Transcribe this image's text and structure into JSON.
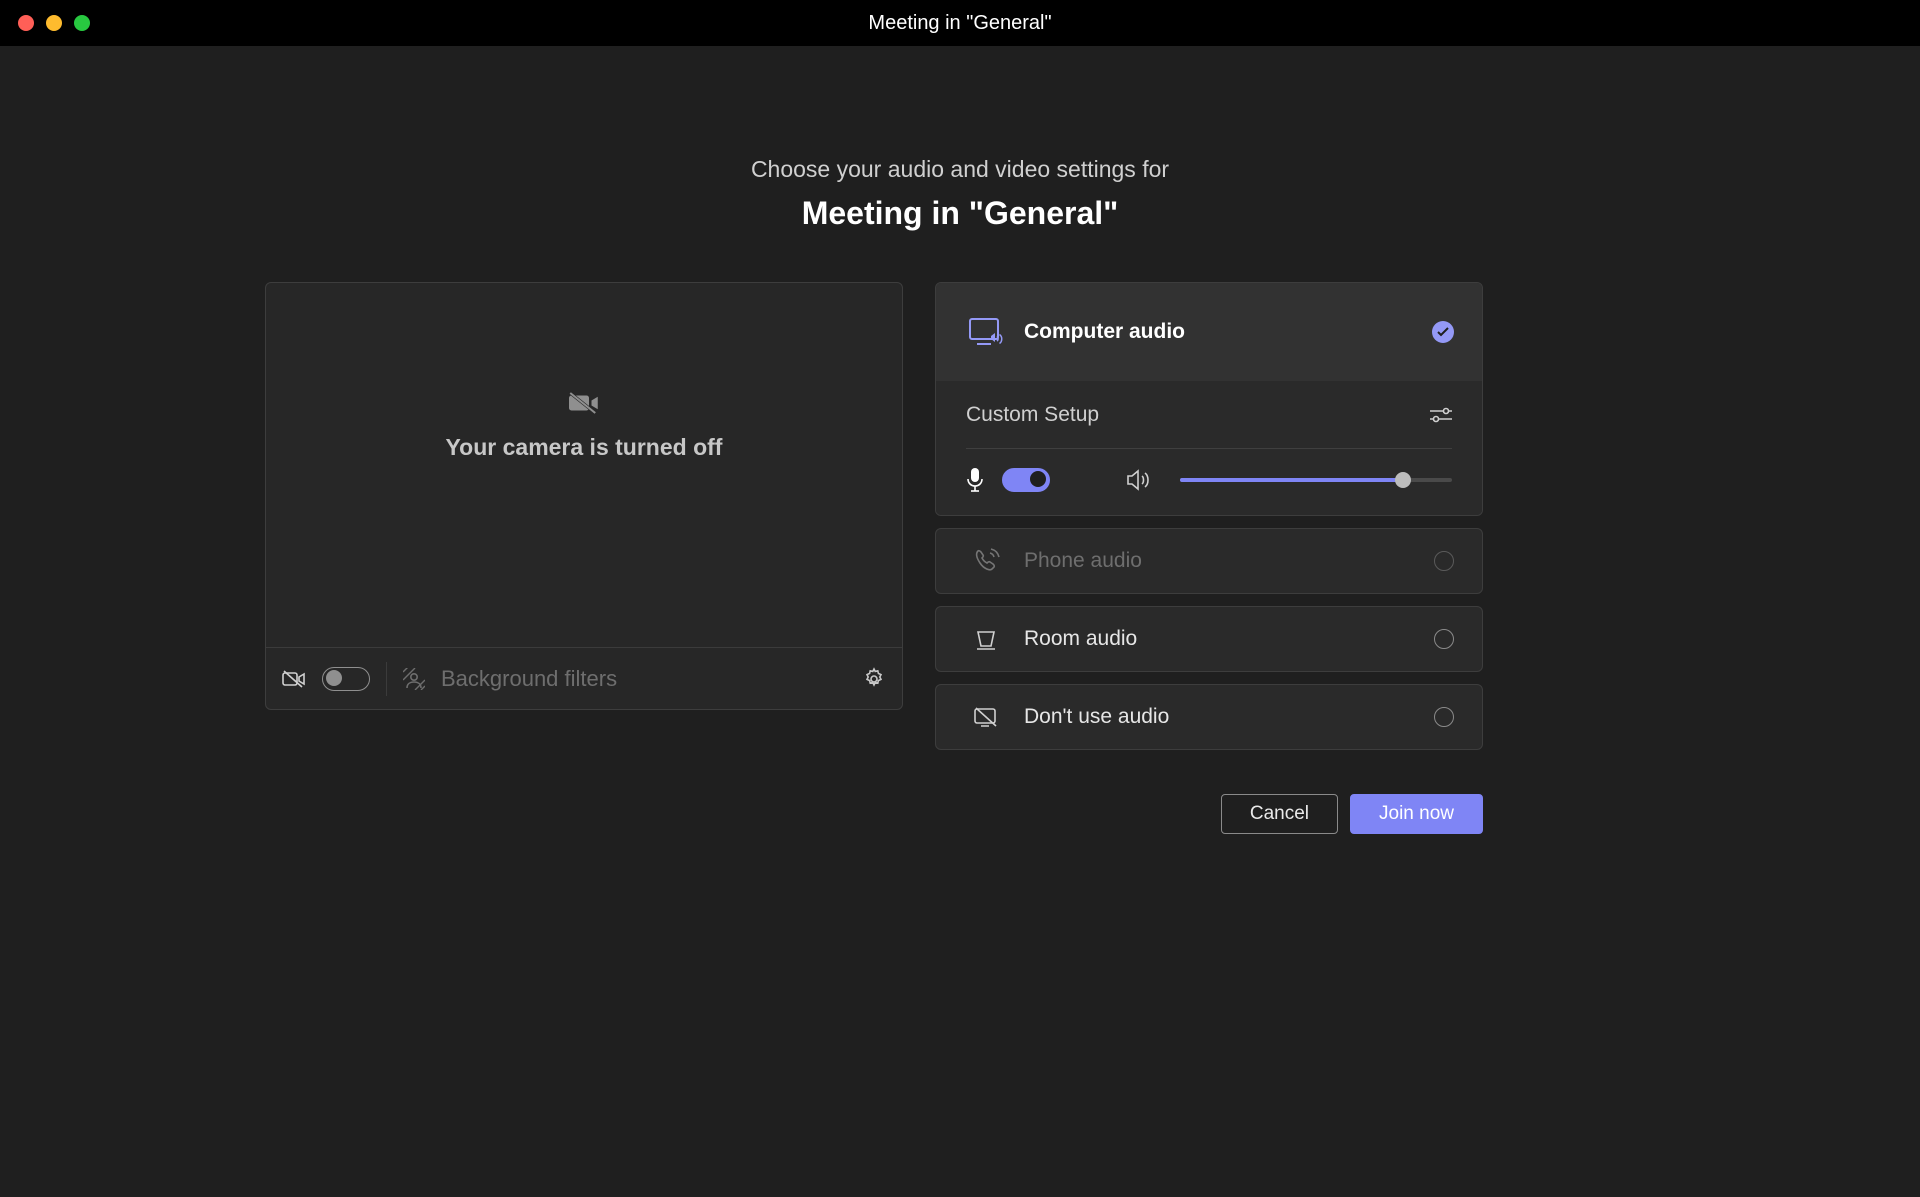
{
  "window": {
    "title": "Meeting in \"General\""
  },
  "header": {
    "subtitle": "Choose your audio and video settings for",
    "title": "Meeting in \"General\""
  },
  "video": {
    "camera_off_text": "Your camera is turned off",
    "camera_on": false,
    "bg_filters_label": "Background filters"
  },
  "audio": {
    "options": {
      "computer": {
        "label": "Computer audio",
        "selected": true
      },
      "phone": {
        "label": "Phone audio",
        "enabled": false
      },
      "room": {
        "label": "Room audio"
      },
      "none": {
        "label": "Don't use audio"
      }
    },
    "custom_setup_label": "Custom Setup",
    "mic_on": true,
    "volume": 82
  },
  "actions": {
    "cancel": "Cancel",
    "join": "Join now"
  }
}
